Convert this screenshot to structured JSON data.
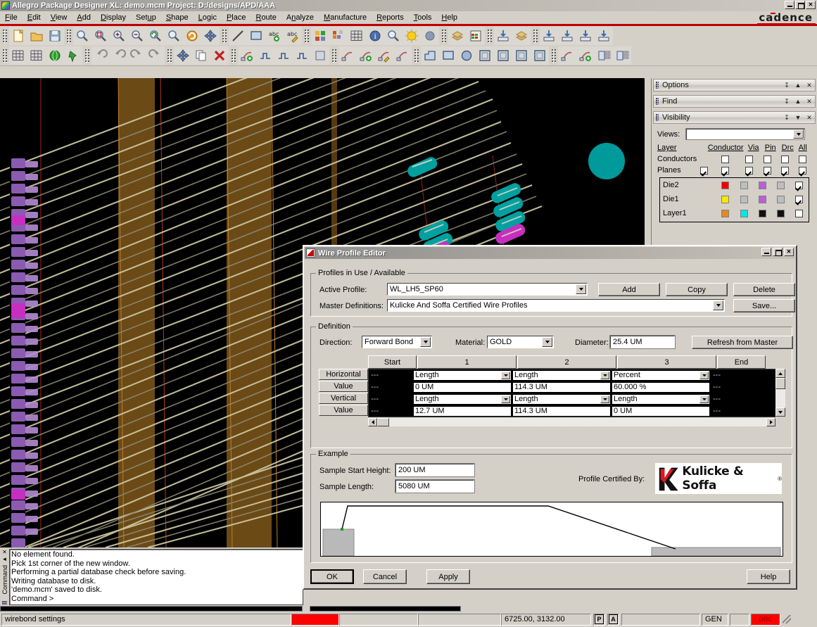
{
  "window": {
    "title": "Allegro Package Designer XL: demo.mcm  Project: D:/designs/APD/AAA",
    "brand": "cadence",
    "min_label": "_",
    "max_label": "□",
    "close_label": "✕"
  },
  "menu": {
    "items": [
      {
        "label": "File",
        "mnemonic": "F"
      },
      {
        "label": "Edit",
        "mnemonic": "E"
      },
      {
        "label": "View",
        "mnemonic": "V"
      },
      {
        "label": "Add",
        "mnemonic": "A"
      },
      {
        "label": "Display",
        "mnemonic": "D"
      },
      {
        "label": "Setup",
        "mnemonic": "u"
      },
      {
        "label": "Shape",
        "mnemonic": "S"
      },
      {
        "label": "Logic",
        "mnemonic": "L"
      },
      {
        "label": "Place",
        "mnemonic": "P"
      },
      {
        "label": "Route",
        "mnemonic": "R"
      },
      {
        "label": "Analyze",
        "mnemonic": "n"
      },
      {
        "label": "Manufacture",
        "mnemonic": "M"
      },
      {
        "label": "Reports",
        "mnemonic": "R"
      },
      {
        "label": "Tools",
        "mnemonic": "T"
      },
      {
        "label": "Help",
        "mnemonic": "H"
      }
    ]
  },
  "toolbar_row1": [
    {
      "name": "new-file-icon",
      "title": "New"
    },
    {
      "name": "open-folder-icon",
      "title": "Open"
    },
    {
      "name": "save-disk-icon",
      "title": "Save"
    },
    {
      "name": "zoom-by-points-icon",
      "title": "Zoom by Points"
    },
    {
      "name": "zoom-fit-icon",
      "title": "Zoom Fit"
    },
    {
      "name": "zoom-in-icon",
      "title": "Zoom In"
    },
    {
      "name": "zoom-out-icon",
      "title": "Zoom Out"
    },
    {
      "name": "zoom-previous-icon",
      "title": "Zoom Previous"
    },
    {
      "name": "zoom-world-icon",
      "title": "Zoom World"
    },
    {
      "name": "redraw-icon",
      "title": "Redraw"
    },
    {
      "name": "move-3d-icon",
      "title": "3D View"
    },
    {
      "name": "add-line-icon",
      "title": "Add Line"
    },
    {
      "name": "add-rect-icon",
      "title": "Add Rectangle"
    },
    {
      "name": "add-text-icon",
      "title": "Add Text"
    },
    {
      "name": "edit-text-icon",
      "title": "Edit Text"
    },
    {
      "name": "color-visibility-icon",
      "title": "Color / Visibility"
    },
    {
      "name": "subclass-icon",
      "title": "Subclass"
    },
    {
      "name": "grid-toggle-icon",
      "title": "Grid Toggle"
    },
    {
      "name": "status-info-icon",
      "title": "Status"
    },
    {
      "name": "measure-icon",
      "title": "Measure"
    },
    {
      "name": "highlight-icon",
      "title": "Highlight"
    },
    {
      "name": "dehighlight-icon",
      "title": "Dehighlight"
    },
    {
      "name": "cross-section-icon",
      "title": "Cross Section"
    },
    {
      "name": "constraint-manager-icon",
      "title": "Constraint Manager"
    },
    {
      "name": "padstack-icon",
      "title": "Padstack"
    },
    {
      "name": "die-stack-icon",
      "title": "Die Stack"
    },
    {
      "name": "import-logic-icon",
      "title": "Import"
    },
    {
      "name": "export-logic-icon",
      "title": "Export"
    },
    {
      "name": "import-die-icon",
      "title": "Import Die"
    },
    {
      "name": "export-die-icon",
      "title": "Export Die"
    }
  ],
  "toolbar_row2": [
    {
      "name": "grid-setup-icon",
      "title": "Grid Setup"
    },
    {
      "name": "grid-net-icon",
      "title": "Net Grid"
    },
    {
      "name": "net-globe-icon",
      "title": "Nets"
    },
    {
      "name": "pin-icon",
      "title": "Pin"
    },
    {
      "name": "undo-icon",
      "title": "Undo"
    },
    {
      "name": "undo-all-icon",
      "title": "Undo All"
    },
    {
      "name": "redo-icon",
      "title": "Redo"
    },
    {
      "name": "redo-all-icon",
      "title": "Redo All"
    },
    {
      "name": "move-icon",
      "title": "Move"
    },
    {
      "name": "copy-icon",
      "title": "Copy"
    },
    {
      "name": "delete-icon",
      "title": "Delete"
    },
    {
      "name": "add-connect-icon",
      "title": "Add Connect"
    },
    {
      "name": "slide-icon",
      "title": "Slide"
    },
    {
      "name": "custom-smooth-icon",
      "title": "Custom Smooth"
    },
    {
      "name": "delay-tune-icon",
      "title": "Delay Tune"
    },
    {
      "name": "route-spread-icon",
      "title": "Spread Between Voids"
    },
    {
      "name": "wirebond-select-icon",
      "title": "Wirebond Select"
    },
    {
      "name": "wirebond-add-icon",
      "title": "Add Wirebond"
    },
    {
      "name": "wirebond-edit-icon",
      "title": "Edit Wirebond"
    },
    {
      "name": "wirebond-query-icon",
      "title": "Query Wirebond"
    },
    {
      "name": "shape-polygon-icon",
      "title": "Shape Polygon"
    },
    {
      "name": "shape-rect-icon",
      "title": "Shape Rectangle"
    },
    {
      "name": "shape-circle-icon",
      "title": "Shape Circle"
    },
    {
      "name": "shape-boundary-icon",
      "title": "Shape Boundary"
    },
    {
      "name": "shape-nest-icon",
      "title": "Nested Shape"
    },
    {
      "name": "shape-void-icon",
      "title": "Shape Void"
    },
    {
      "name": "shape-select-icon",
      "title": "Select Shape"
    },
    {
      "name": "bond-finger-array-icon",
      "title": "Bond Finger Array"
    },
    {
      "name": "add-bond-finger-icon",
      "title": "Add Bond Finger"
    },
    {
      "name": "ball-array-edit-icon",
      "title": "Edit Ball Array"
    },
    {
      "name": "ball-array-add-icon",
      "title": "Add Ball Array"
    }
  ],
  "dock": {
    "panels": [
      {
        "name": "options",
        "title": "Options",
        "collapse_glyph": "▲"
      },
      {
        "name": "find",
        "title": "Find",
        "collapse_glyph": "▲"
      },
      {
        "name": "visibility",
        "title": "Visibility",
        "collapse_glyph": "▼"
      }
    ],
    "pin_glyph": "↧",
    "close_glyph": "✕",
    "visibility": {
      "views_label": "Views:",
      "views_value": "",
      "columns": [
        "Layer",
        "Conductor",
        "Via",
        "Pin",
        "Drc",
        "All"
      ],
      "rows": [
        {
          "label": "Conductors",
          "master": null,
          "checks": [
            false,
            false,
            false,
            false,
            false
          ]
        },
        {
          "label": "Planes",
          "master": true,
          "checks": [
            true,
            true,
            true,
            true,
            true
          ]
        }
      ],
      "layers": [
        {
          "label": "Die2",
          "swatches": [
            "#f00000",
            "#bdbdbd",
            "#bb5fd6",
            "#bdbdbd"
          ],
          "visible": true
        },
        {
          "label": "Die1",
          "swatches": [
            "#f7e800",
            "#bdbdbd",
            "#bb5fd6",
            "#bdbdbd"
          ],
          "visible": true
        },
        {
          "label": "Layer1",
          "swatches": [
            "#e08a2e",
            "#00e5e5",
            "#101010",
            "#101010"
          ],
          "visible": false
        }
      ]
    }
  },
  "console": {
    "lines": [
      "No element found.",
      "Pick 1st corner of the new window.",
      "Performing a partial database check before saving.",
      "Writing database to disk.",
      "'demo.mcm' saved to disk.",
      "Command >"
    ],
    "vertical_label": "Command",
    "close_glyph": "✕",
    "collapse_glyph": "◄"
  },
  "status": {
    "message": "wirebond settings",
    "color_swatch": "#ff0000",
    "coordinates": "6725.00, 3132.00",
    "mode_p": "P",
    "mode_a": "A",
    "gen": "GEN",
    "drc": "DRC",
    "drc_color": "#ff0000"
  },
  "dialog": {
    "title": "Wire Profile Editor",
    "min_label": "_",
    "max_label": "□",
    "close_label": "✕",
    "profiles_group": {
      "legend": "Profiles in Use / Available",
      "active_profile_label": "Active Profile:",
      "active_profile_value": "WL_LH5_SP60",
      "master_definitions_label": "Master Definitions:",
      "master_definitions_value": "Kulicke And Soffa Certified Wire Profiles",
      "buttons": [
        "Add",
        "Copy",
        "Delete",
        "Save..."
      ]
    },
    "definition_group": {
      "legend": "Definition",
      "direction_label": "Direction:",
      "direction_value": "Forward Bond",
      "material_label": "Material:",
      "material_value": "GOLD",
      "diameter_label": "Diameter:",
      "diameter_value": "25.4 UM",
      "refresh_button": "Refresh from Master",
      "columns": [
        "Start",
        "1",
        "2",
        "3",
        "End"
      ],
      "rows": [
        {
          "label": "Horizontal",
          "type": "combo",
          "start": "---",
          "cells": [
            "Length",
            "Length",
            "Percent"
          ],
          "end": "---"
        },
        {
          "label": "Value",
          "type": "text",
          "start": "---",
          "cells": [
            "0 UM",
            "114.3 UM",
            "60.000 %"
          ],
          "end": "---"
        },
        {
          "label": "Vertical",
          "type": "combo",
          "start": "---",
          "cells": [
            "Length",
            "Length",
            "Length"
          ],
          "end": "---"
        },
        {
          "label": "Value",
          "type": "text",
          "start": "---",
          "cells": [
            "12.7 UM",
            "114.3 UM",
            "0 UM"
          ],
          "end": "---"
        }
      ]
    },
    "example_group": {
      "legend": "Example",
      "sample_start_height_label": "Sample Start Height:",
      "sample_start_height_value": "200 UM",
      "sample_length_label": "Sample Length:",
      "sample_length_value": "5080 UM",
      "certified_by_label": "Profile Certified By:",
      "logo_text": "Kulicke & Soffa",
      "logo_mark_color": "#d81921"
    },
    "footer": {
      "ok": "OK",
      "cancel": "Cancel",
      "apply": "Apply",
      "help": "Help"
    }
  }
}
